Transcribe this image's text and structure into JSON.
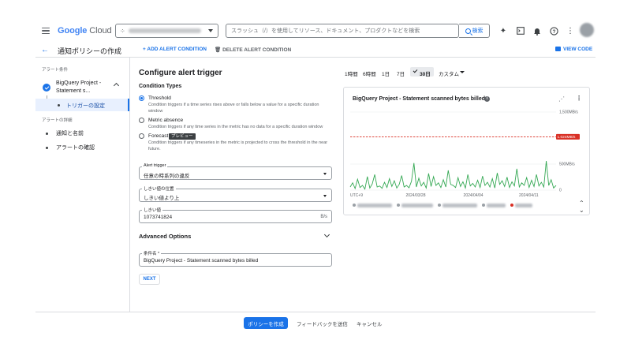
{
  "topbar": {
    "logo_google": "Google",
    "logo_cloud": "Cloud",
    "search_placeholder": "スラッシュ（/）を使用してリソース、ドキュメント、プロダクトなどを検索",
    "search_button": "検索",
    "icons": [
      "gemini-icon",
      "terminal-icon",
      "bell-icon",
      "help-icon",
      "more-vert-icon"
    ]
  },
  "header": {
    "title": "通知ポリシーの作成",
    "add_condition": "ADD ALERT CONDITION",
    "delete_condition": "DELETE ALERT CONDITION",
    "view_code": "VIEW CODE"
  },
  "nav": {
    "section_conditions": "アラート条件",
    "project_item": "BigQuery Project - Statement s...",
    "trigger_item": "トリガーの設定",
    "section_details": "アラートの詳細",
    "notify_item": "通知と名前",
    "review_item": "アラートの確認"
  },
  "form": {
    "title": "Configure alert trigger",
    "condition_types_label": "Condition Types",
    "options": [
      {
        "name": "Threshold",
        "desc": "Condition triggers if a time series rises above or falls below a value for a specific duration window",
        "selected": true
      },
      {
        "name": "Metric absence",
        "desc": "Condition triggers if any time series in the metric has no data for a specific duration window",
        "selected": false
      },
      {
        "name": "Forecast",
        "desc": "Condition triggers if any timeseries in the metric is projected to cross the threshold in the near future.",
        "selected": false
      }
    ],
    "forecast_badge": "プレビュー",
    "alert_trigger": {
      "label": "Alert trigger",
      "value": "任意の時系列の違反"
    },
    "threshold_position": {
      "label": "しきい値の位置",
      "value": "しきい値より上"
    },
    "threshold_value": {
      "label": "しきい値",
      "value": "1073741824",
      "unit": "B/s"
    },
    "advanced_options": "Advanced Options",
    "condition_name": {
      "label": "条件名 *",
      "value": "BigQuery Project - Statement scanned bytes billed"
    },
    "next_button": "NEXT"
  },
  "time_range": {
    "options": [
      "1時間",
      "6時間",
      "1日",
      "7日",
      "30日",
      "カスタム"
    ],
    "selected": "30日"
  },
  "chart_data": {
    "type": "line",
    "title": "BigQuery Project - Statement scanned bytes billed",
    "y_tick_labels": [
      "1,500MB/s",
      "500MB/s",
      "0"
    ],
    "threshold_label": "1.024MB/s",
    "threshold_value": 1024,
    "ylim": [
      0,
      1500
    ],
    "x_tick_labels": [
      "UTC+9",
      "2024/03/28",
      "2024/04/04",
      "2024/04/11"
    ],
    "x_start": "2024/03/20",
    "x_end": "2024/04/18",
    "colors": {
      "series": "#34a853",
      "threshold": "#d93025"
    },
    "series": [
      {
        "values": [
          60,
          140,
          30,
          210,
          50,
          90,
          20,
          260,
          40,
          120,
          300,
          60,
          80,
          35,
          150,
          50,
          220,
          70,
          180,
          40,
          110,
          280,
          60,
          90,
          45,
          170,
          520,
          60,
          230,
          80,
          150,
          40,
          320,
          70,
          260,
          90,
          140,
          50,
          200,
          60,
          380,
          110,
          90,
          50,
          240,
          70,
          160,
          40,
          300,
          80,
          130,
          60,
          190,
          50,
          270,
          90,
          150,
          60,
          220,
          40,
          330,
          110,
          180,
          70,
          250,
          50,
          160,
          80,
          410,
          60,
          140,
          90,
          240,
          50,
          190,
          70,
          300,
          80,
          150,
          60,
          560,
          90,
          200,
          40,
          90
        ]
      }
    ]
  },
  "footer": {
    "create_button": "ポリシーを作成",
    "feedback": "フィードバックを送信",
    "cancel": "キャンセル"
  }
}
